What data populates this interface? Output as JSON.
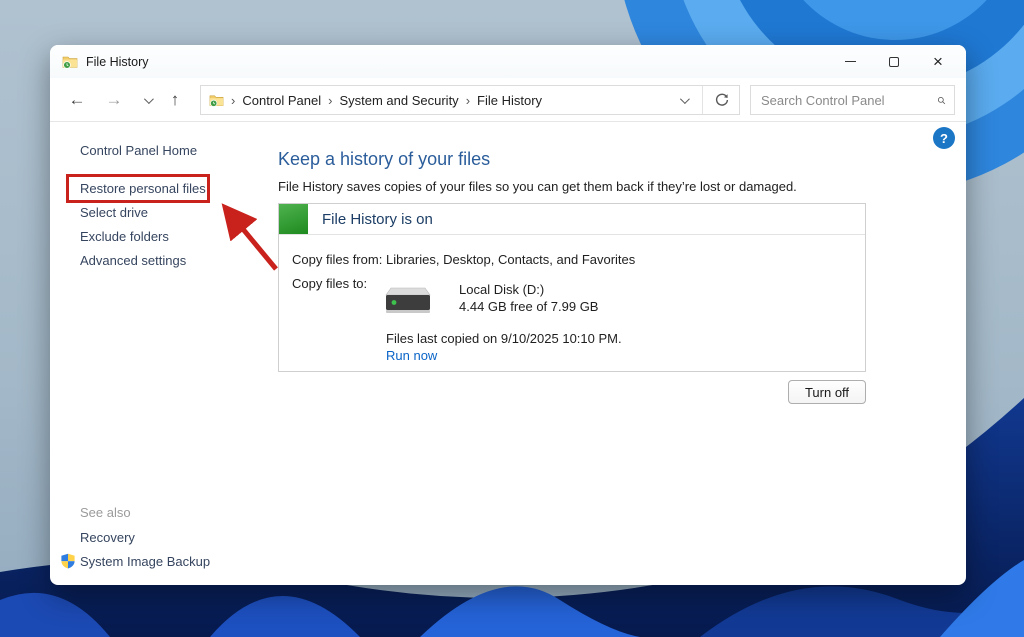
{
  "window": {
    "title": "File History",
    "controls": {
      "close": "×"
    }
  },
  "navbar": {
    "icons": {
      "back": "←",
      "forward": "→",
      "up": "↑"
    },
    "breadcrumb": {
      "sep": "›",
      "items": [
        "Control Panel",
        "System and Security",
        "File History"
      ]
    },
    "search_placeholder": "Search Control Panel"
  },
  "sidebar": {
    "home": "Control Panel Home",
    "tasks": [
      "Restore personal files",
      "Select drive",
      "Exclude folders",
      "Advanced settings"
    ],
    "see_also": "See also",
    "links": [
      "Recovery",
      "System Image Backup"
    ]
  },
  "main": {
    "heading": "Keep a history of your files",
    "description": "File History saves copies of your files so you can get them back if they’re lost or damaged.",
    "panel": {
      "status_title": "File History is on",
      "copy_from_label": "Copy files from:",
      "copy_from_value": "Libraries, Desktop, Contacts, and Favorites",
      "copy_to_label": "Copy files to:",
      "drive_name": "Local Disk (D:)",
      "drive_space": "4.44 GB free of 7.99 GB",
      "last_copied": "Files last copied on 9/10/2025 10:10 PM.",
      "run_now_label": "Run now"
    },
    "turn_off_label": "Turn off",
    "help_label": "?"
  },
  "colors": {
    "accent_heading": "#2b5d9b",
    "status_green": "#2e9e2e",
    "annotation_red": "#c9211c",
    "link_blue": "#0a64c8"
  }
}
